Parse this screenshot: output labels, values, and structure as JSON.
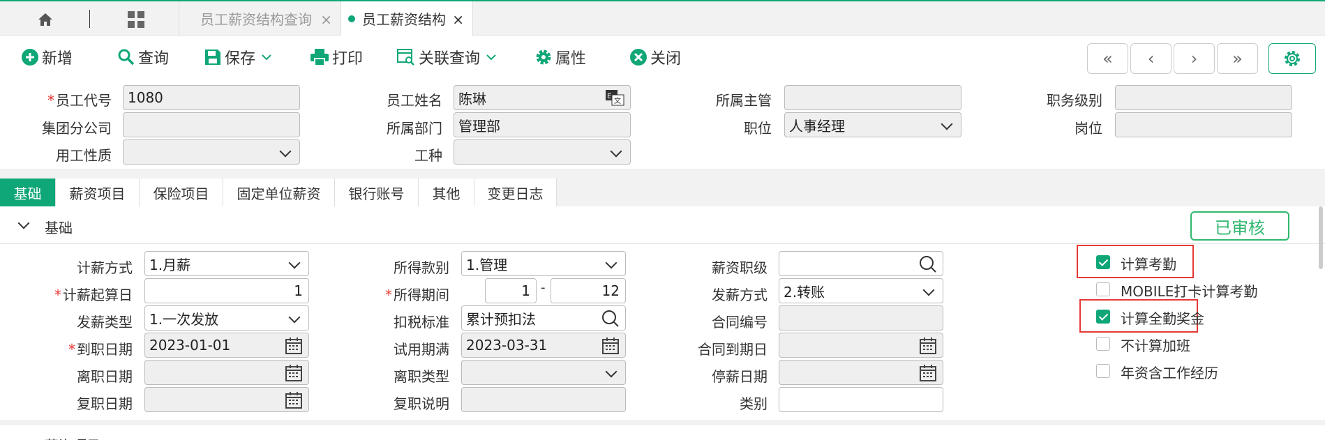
{
  "tabs": [
    {
      "label": "员工薪资结构查询"
    },
    {
      "label": "员工薪资结构"
    }
  ],
  "tab_close": "×",
  "toolbar": {
    "add": "新增",
    "query": "查询",
    "save": "保存",
    "print": "打印",
    "link_query": "关联查询",
    "props": "属性",
    "close": "关闭"
  },
  "nav": [
    "«",
    "‹",
    "›",
    "»"
  ],
  "header": {
    "emp_code_label": "员工代号",
    "emp_code": "1080",
    "emp_name_label": "员工姓名",
    "emp_name": "陈琳",
    "supervisor_label": "所属主管",
    "supervisor": "",
    "duty_level_label": "职务级别",
    "duty_level": "",
    "branch_label": "集团分公司",
    "branch": "",
    "dept_label": "所属部门",
    "dept": "管理部",
    "position_label": "职位",
    "position": "人事经理",
    "post_label": "岗位",
    "post": "",
    "employ_type_label": "用工性质",
    "employ_type": "",
    "work_type_label": "工种",
    "work_type": ""
  },
  "subtabs": [
    "基础",
    "薪资项目",
    "保险项目",
    "固定单位薪资",
    "银行账号",
    "其他",
    "变更日志"
  ],
  "basic": {
    "title": "基础",
    "stamp": "已审核",
    "pay_method_label": "计薪方式",
    "pay_method": "1.月薪",
    "pay_start_label": "计薪起算日",
    "pay_start": "1",
    "pay_kind_label": "发薪类型",
    "pay_kind": "1.一次发放",
    "join_date_label": "到职日期",
    "join_date": "2023-01-01",
    "leave_date_label": "离职日期",
    "leave_date": "",
    "rejoin_date_label": "复职日期",
    "rejoin_date": "",
    "income_type_label": "所得款别",
    "income_type": "1.管理",
    "income_period_label": "所得期间",
    "income_period_from": "1",
    "income_period_to": "12",
    "tax_std_label": "扣税标准",
    "tax_std": "累计预扣法",
    "probation_label": "试用期满",
    "probation": "2023-03-31",
    "leave_type_label": "离职类型",
    "leave_type": "",
    "rejoin_note_label": "复职说明",
    "rejoin_note": "",
    "salary_grade_label": "薪资职级",
    "salary_grade": "",
    "pay_way_label": "发薪方式",
    "pay_way": "2.转账",
    "contract_no_label": "合同编号",
    "contract_no": "",
    "contract_end_label": "合同到期日",
    "contract_end": "",
    "stop_pay_label": "停薪日期",
    "stop_pay": "",
    "category_label": "类别",
    "category": "",
    "dash": "-"
  },
  "checks": [
    {
      "label": "计算考勤",
      "checked": true
    },
    {
      "label": "MOBILE打卡计算考勤",
      "checked": false
    },
    {
      "label": "计算全勤奖金",
      "checked": true
    },
    {
      "label": "不计算加班",
      "checked": false
    },
    {
      "label": "年资含工作经历",
      "checked": false
    }
  ],
  "next_section": "薪资项目",
  "colors": {
    "accent": "#0fa678",
    "stamp": "#2fb86e",
    "highlight": "#e53935"
  }
}
